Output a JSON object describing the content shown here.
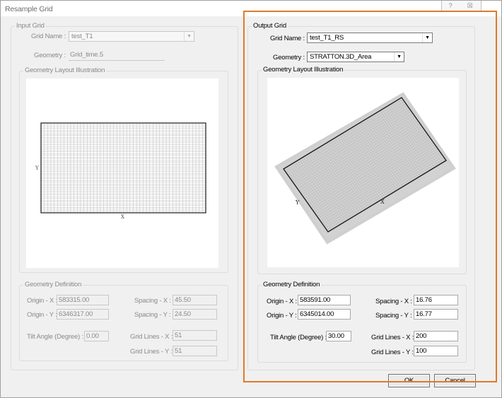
{
  "window": {
    "title": "Resample Grid",
    "help_glyph": "?",
    "close_glyph": "☒"
  },
  "input_grid": {
    "legend": "Input Grid",
    "grid_name_label": "Grid Name :",
    "grid_name_value": "test_T1",
    "geometry_label": "Geometry :",
    "geometry_value": "Grid_time.5",
    "layout_legend": "Geometry Layout Illustration",
    "axis_x": "X",
    "axis_y": "Y",
    "definition_legend": "Geometry Definition",
    "origin_x_label": "Origin - X :",
    "origin_x_value": "583315.00",
    "origin_y_label": "Origin - Y :",
    "origin_y_value": "6346317.00",
    "spacing_x_label": "Spacing - X :",
    "spacing_x_value": "45.50",
    "spacing_y_label": "Spacing - Y :",
    "spacing_y_value": "24.50",
    "tilt_label": "Tilt Angle (Degree) :",
    "tilt_value": "0.00",
    "lines_x_label": "Grid Lines - X :",
    "lines_x_value": "51",
    "lines_y_label": "Grid Lines - Y :",
    "lines_y_value": "51"
  },
  "output_grid": {
    "legend": "Output Grid",
    "grid_name_label": "Grid Name :",
    "grid_name_value": "test_T1_RS",
    "geometry_label": "Geometry :",
    "geometry_value": "STRATTON.3D_Area",
    "layout_legend": "Geometry Layout Illustration",
    "axis_x": "X",
    "axis_y": "Y",
    "definition_legend": "Geometry Definition",
    "origin_x_label": "Origin - X :",
    "origin_x_value": "583591.00",
    "origin_y_label": "Origin - Y :",
    "origin_y_value": "6345014.00",
    "spacing_x_label": "Spacing - X :",
    "spacing_x_value": "16.76",
    "spacing_y_label": "Spacing - Y :",
    "spacing_y_value": "16.77",
    "tilt_label": "Tilt Angle (Degree) :",
    "tilt_value": "30.00",
    "lines_x_label": "Grid Lines - X :",
    "lines_x_value": "200",
    "lines_y_label": "Grid Lines - Y :",
    "lines_y_value": "100"
  },
  "buttons": {
    "ok": "OK",
    "cancel": "Cancel"
  },
  "colors": {
    "highlight": "#e07a2a",
    "grid_line": "#bdbdbd",
    "grid_border": "#2a2a2a"
  }
}
